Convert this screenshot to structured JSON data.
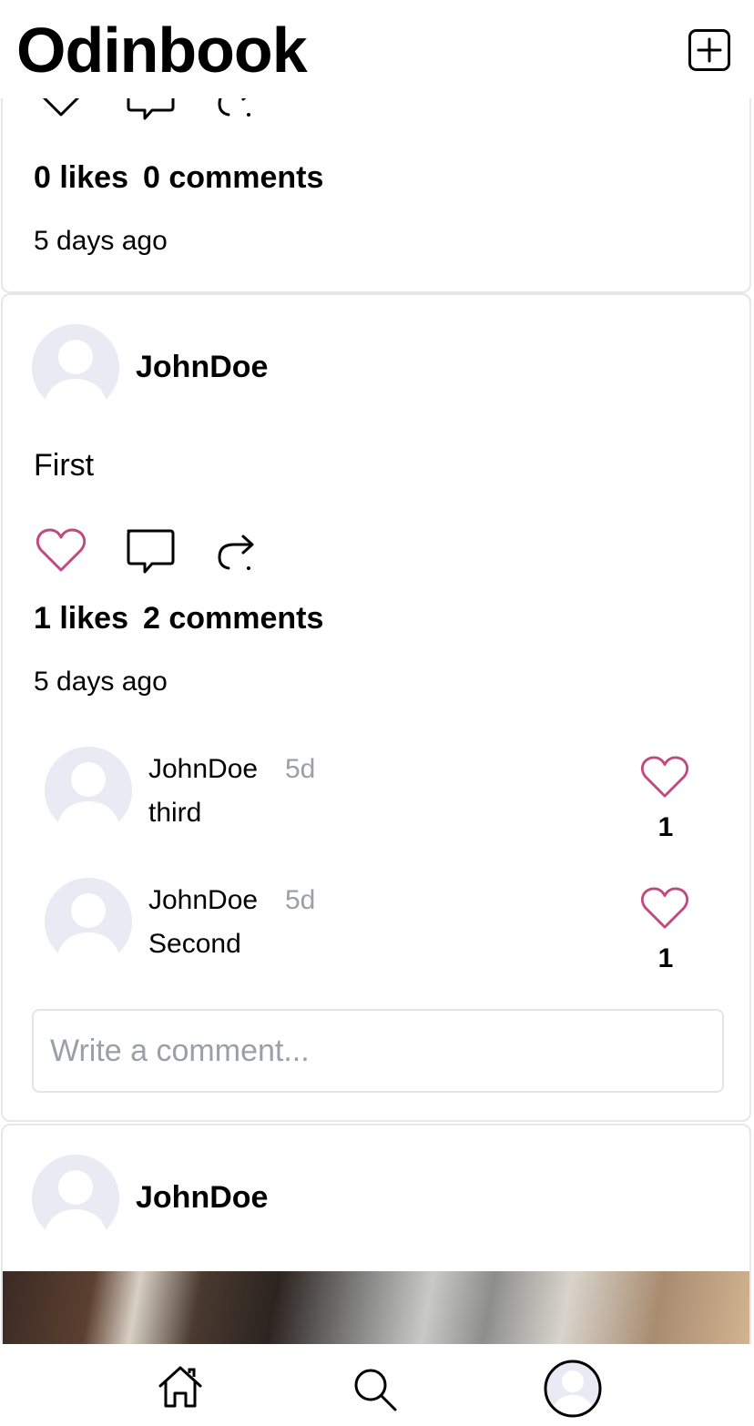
{
  "app": {
    "title": "Odinbook"
  },
  "colors": {
    "like_active": "#c2497f",
    "avatar_bg": "#e8ebf3",
    "muted_text": "#9aa0a8",
    "border": "#e5e7eb"
  },
  "icons": {
    "header": "plus-square-icon",
    "actions": [
      "heart-icon",
      "comment-icon",
      "share-icon"
    ],
    "nav": [
      "home-icon",
      "search-icon",
      "profile-avatar-icon"
    ]
  },
  "posts": [
    {
      "likes_label": "0 likes",
      "comments_label": "0 comments",
      "time": "5 days ago",
      "liked": false
    },
    {
      "author": "JohnDoe",
      "content": "First",
      "likes_label": "1 likes",
      "comments_label": "2 comments",
      "time": "5 days ago",
      "liked": true,
      "comments": [
        {
          "author": "JohnDoe",
          "age": "5d",
          "text": "third",
          "likes": "1"
        },
        {
          "author": "JohnDoe",
          "age": "5d",
          "text": "Second",
          "likes": "1"
        }
      ],
      "comment_placeholder": "Write a comment..."
    },
    {
      "author": "JohnDoe"
    }
  ]
}
